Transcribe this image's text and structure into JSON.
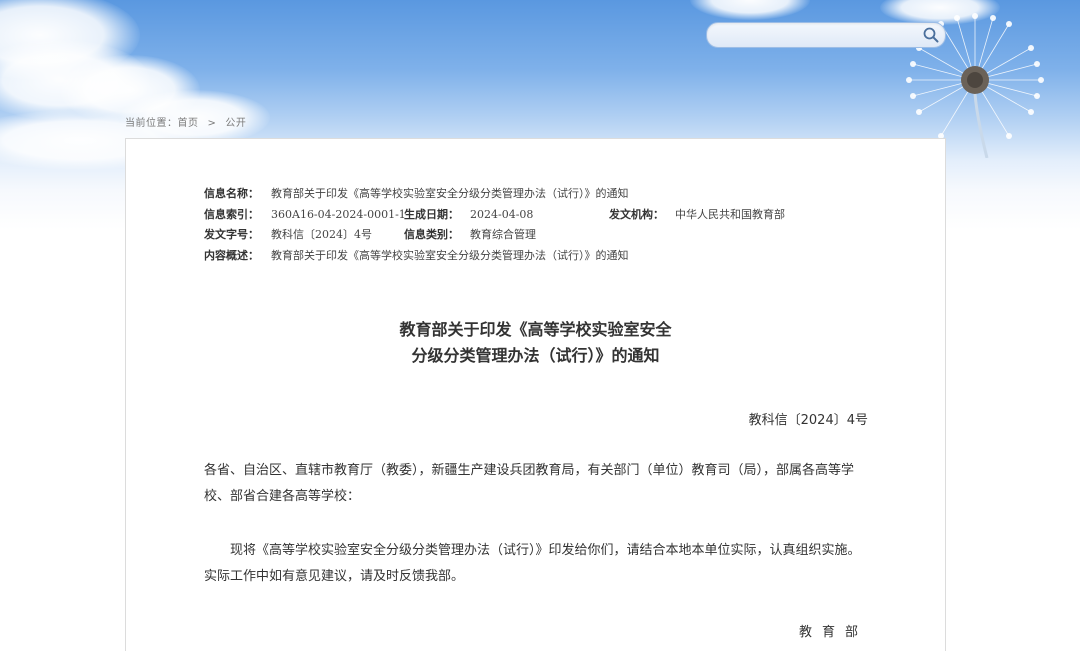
{
  "search": {
    "placeholder": ""
  },
  "breadcrumb": {
    "label": "当前位置：",
    "home": "首页",
    "separator": ">",
    "current": "公开"
  },
  "meta": {
    "info_name_label": "信息名称：",
    "info_name_value": "教育部关于印发《高等学校实验室安全分级分类管理办法（试行）》的通知",
    "index_label": "信息索引：",
    "index_value": "360A16-04-2024-0001-1",
    "date_label": "生成日期：",
    "date_value": "2024-04-08",
    "issuer_label": "发文机构：",
    "issuer_value": "中华人民共和国教育部",
    "doc_no_label": "发文字号：",
    "doc_no_value": "教科信〔2024〕4号",
    "category_label": "信息类别：",
    "category_value": "教育综合管理",
    "summary_label": "内容概述：",
    "summary_value": "教育部关于印发《高等学校实验室安全分级分类管理办法（试行）》的通知"
  },
  "document": {
    "title_line1": "教育部关于印发《高等学校实验室安全",
    "title_line2": "分级分类管理办法（试行）》的通知",
    "doc_number": "教科信〔2024〕4号",
    "paragraph1": "各省、自治区、直辖市教育厅（教委），新疆生产建设兵团教育局，有关部门（单位）教育司（局），部属各高等学校、部省合建各高等学校：",
    "paragraph2": "现将《高等学校实验室安全分级分类管理办法（试行）》印发给你们，请结合本地本单位实际，认真组织实施。实际工作中如有意见建议，请及时反馈我部。",
    "signature": "教育部"
  },
  "colors": {
    "sky_top": "#5a98e0",
    "search_border": "#9cbde6",
    "search_icon": "#4a6f9c",
    "card_border": "#dcdcdc"
  }
}
